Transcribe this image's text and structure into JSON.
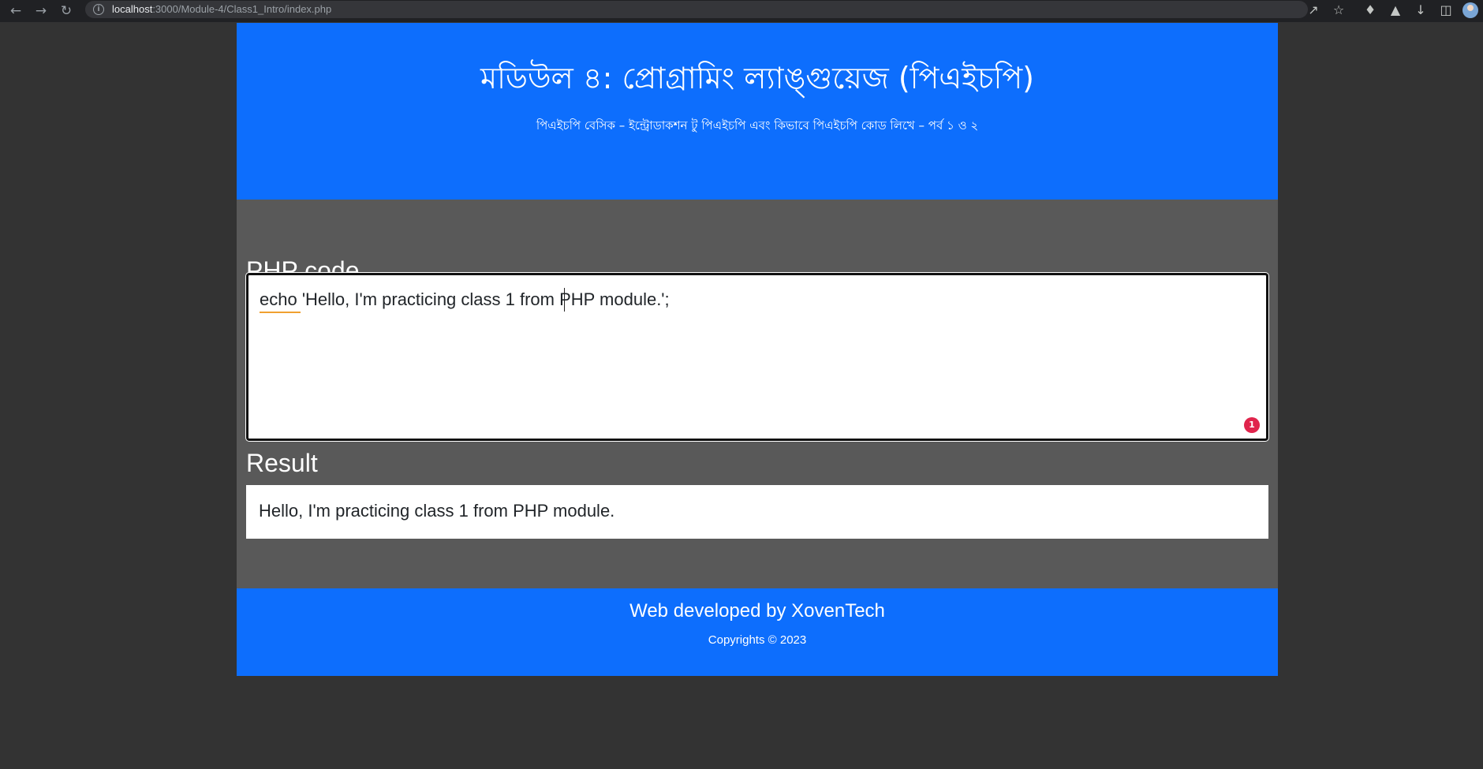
{
  "browser": {
    "url_host": "localhost",
    "url_path": ":3000/Module-4/Class1_Intro/index.php",
    "icons": [
      "back-arrow-icon",
      "forward-arrow-icon",
      "reload-icon",
      "info-icon",
      "share-icon",
      "star-icon",
      "extensions-icon",
      "labs-icon",
      "download-icon",
      "sidebar-icon",
      "profile-avatar"
    ]
  },
  "header": {
    "title": "মডিউল ৪: প্রোগ্রামিং ল্যাঙ্গুয়েজ (পিএইচপি)",
    "subtitle": "পিএইচপি বেসিক – ইন্ট্রোডাকশন টু পিএইচপি এবং কিভাবে পিএইচপি কোড লিখে – পর্ব ১ ও ২"
  },
  "editor": {
    "heading": "PHP code",
    "code": "echo 'Hello, I'm practicing class 1 from PHP module.';",
    "lint_count": "1"
  },
  "result": {
    "heading": "Result",
    "output": "Hello, I'm practicing class 1 from PHP module."
  },
  "footer": {
    "title": "Web developed by XovenTech",
    "copyright": "Copyrights © 2023"
  },
  "colors": {
    "brand_blue": "#0d6efd",
    "content_gray": "#595959",
    "page_bg": "#333333",
    "lint_red": "#e0244c"
  }
}
